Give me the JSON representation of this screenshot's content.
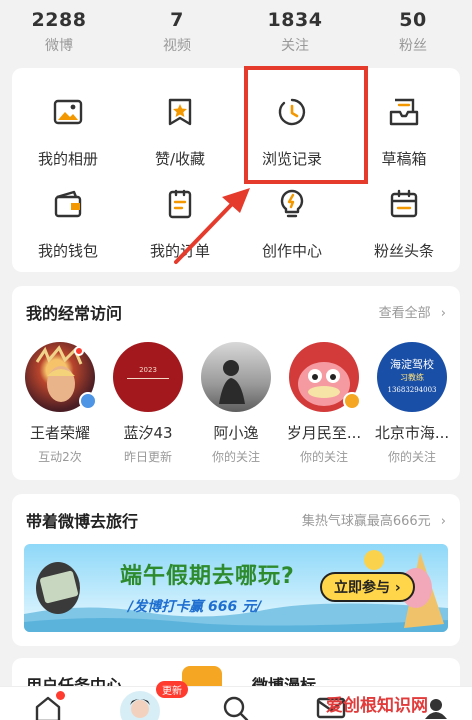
{
  "stats": [
    {
      "value": "2288",
      "label": "微博"
    },
    {
      "value": "7",
      "label": "视频"
    },
    {
      "value": "1834",
      "label": "关注"
    },
    {
      "value": "50",
      "label": "粉丝"
    }
  ],
  "grid": [
    {
      "label": "我的相册",
      "icon": "photo-album-icon"
    },
    {
      "label": "赞/收藏",
      "icon": "star-bookmark-icon"
    },
    {
      "label": "浏览记录",
      "icon": "history-clock-icon"
    },
    {
      "label": "草稿箱",
      "icon": "draft-box-icon"
    },
    {
      "label": "我的钱包",
      "icon": "wallet-icon"
    },
    {
      "label": "我的订单",
      "icon": "order-list-icon"
    },
    {
      "label": "创作中心",
      "icon": "lightbulb-icon"
    },
    {
      "label": "粉丝头条",
      "icon": "fan-headline-icon"
    }
  ],
  "frequent": {
    "title": "我的经常访问",
    "more": "查看全部",
    "items": [
      {
        "name": "王者荣耀",
        "sub": "互动2次"
      },
      {
        "name": "蓝汐43",
        "sub": "昨日更新",
        "avatar_text": "2023"
      },
      {
        "name": "阿小逸",
        "sub": "你的关注"
      },
      {
        "name": "岁月民至...",
        "sub": "你的关注"
      },
      {
        "name": "北京市海...",
        "sub": "你的关注",
        "avatar_text_1": "海淀驾校",
        "avatar_text_2": "习教练",
        "avatar_text_3": "13683294003"
      }
    ]
  },
  "travel": {
    "title": "带着微博去旅行",
    "promo": "集热气球赢最高666元",
    "banner_headline": "端午假期去哪玩?",
    "banner_sub": "/发博打卡赢 666 元/",
    "banner_button": "立即参与"
  },
  "tasks": {
    "left_title": "用户任务中心",
    "right_title": "微博漫标"
  },
  "tabbar": {
    "update_badge": "更新"
  },
  "watermark": "爱创根知识网",
  "colors": {
    "accent_red": "#e53b2c",
    "icon_dark": "#333333",
    "icon_orange": "#f39800"
  }
}
